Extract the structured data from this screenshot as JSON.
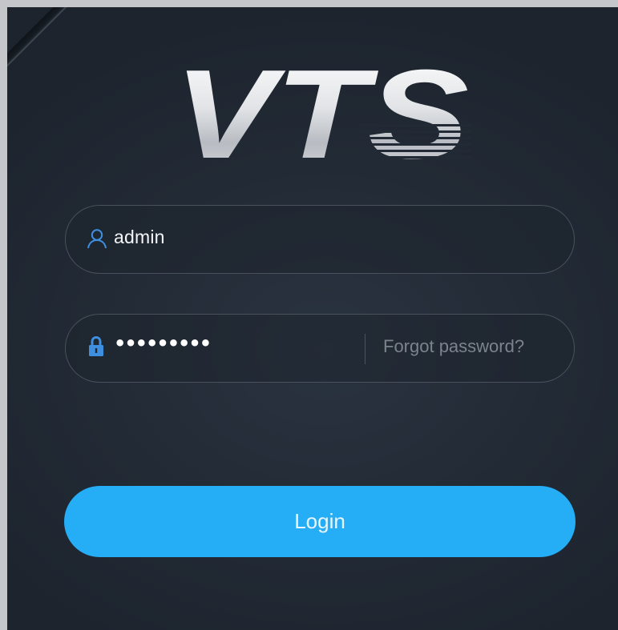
{
  "logo": {
    "text": "VTS"
  },
  "username": {
    "value": "admin",
    "icon": "user-icon"
  },
  "password": {
    "value": "•••••••••",
    "icon": "lock-icon"
  },
  "forgot": {
    "label": "Forgot password?"
  },
  "login": {
    "label": "Login"
  },
  "colors": {
    "background": "#222a35",
    "accent": "#25aef5",
    "field_border": "#48515c",
    "muted_text": "#7b838d",
    "icon_blue": "#3e8fe0"
  }
}
